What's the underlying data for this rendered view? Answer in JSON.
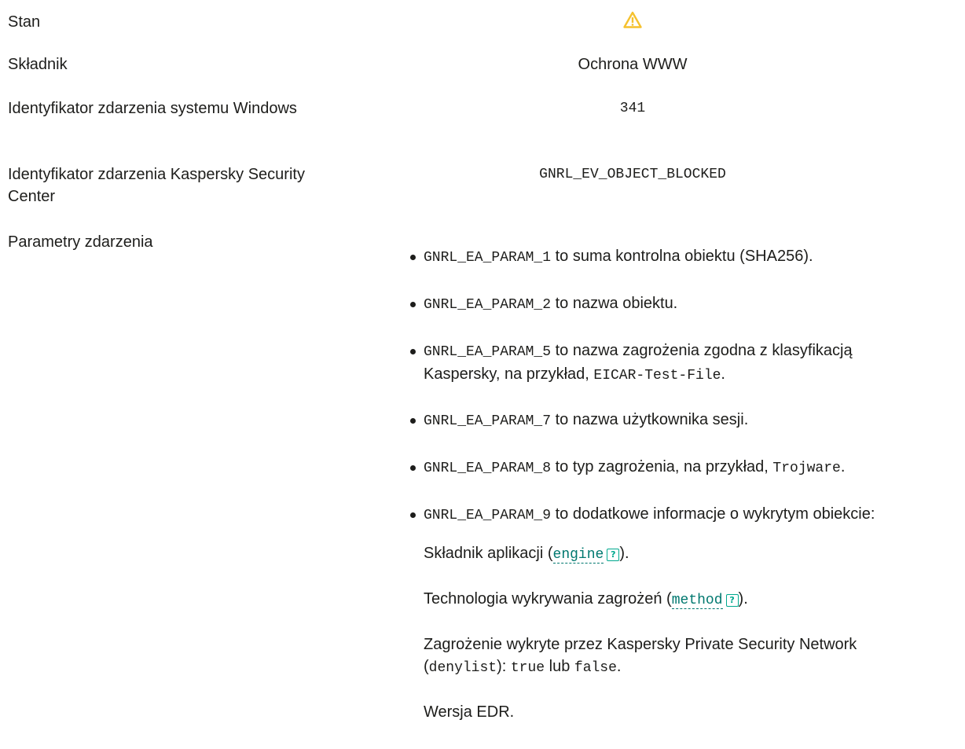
{
  "rows": {
    "stan": {
      "label": "Stan",
      "icon": "warning-triangle-icon",
      "icon_color": "#f5c12e"
    },
    "skladnik": {
      "label": "Składnik",
      "value": "Ochrona WWW"
    },
    "win_id": {
      "label": "Identyfikator zdarzenia systemu Windows",
      "value": "341"
    },
    "ksc_id": {
      "label": "Identyfikator zdarzenia Kaspersky Security Center",
      "value": "GNRL_EV_OBJECT_BLOCKED"
    },
    "params_label": "Parametry zdarzenia"
  },
  "params": [
    {
      "code": "GNRL_EA_PARAM_1",
      "text": " to suma kontrolna obiektu (SHA256)."
    },
    {
      "code": "GNRL_EA_PARAM_2",
      "text": " to nazwa obiektu."
    },
    {
      "code": "GNRL_EA_PARAM_5",
      "text_a": " to nazwa zagrożenia zgodna z klasyfikacją",
      "text_b": "Kaspersky, na przykład, ",
      "example": "EICAR-Test-File",
      "end": "."
    },
    {
      "code": "GNRL_EA_PARAM_7",
      "text": " to nazwa użytkownika sesji."
    },
    {
      "code": "GNRL_EA_PARAM_8",
      "text": " to typ zagrożenia, na przykład, ",
      "example": "Trojware",
      "end": "."
    },
    {
      "code": "GNRL_EA_PARAM_9",
      "text": " to dodatkowe informacje o wykrytym obiekcie:"
    }
  ],
  "param9_details": {
    "engine_prefix": "Składnik aplikacji (",
    "engine_link": "engine",
    "engine_suffix": ").",
    "method_prefix": "Technologia wykrywania zagrożeń (",
    "method_link": "method",
    "method_suffix": ").",
    "ksn_line1": "Zagrożenie wykryte przez Kaspersky Private Security Network",
    "ksn_open": "(",
    "ksn_code": "denylist",
    "ksn_mid": "): ",
    "ksn_true": "true",
    "ksn_or": " lub ",
    "ksn_false": "false",
    "ksn_end": ".",
    "edr": "Wersja EDR.",
    "help_glyph": "?"
  }
}
